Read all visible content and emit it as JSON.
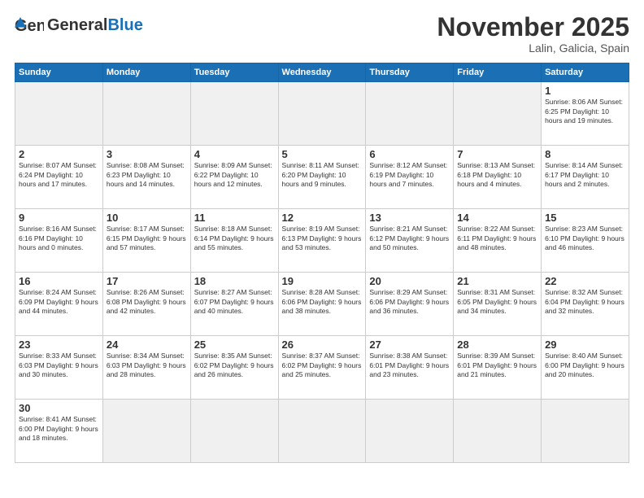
{
  "header": {
    "logo_general": "General",
    "logo_blue": "Blue",
    "month": "November 2025",
    "location": "Lalin, Galicia, Spain"
  },
  "weekdays": [
    "Sunday",
    "Monday",
    "Tuesday",
    "Wednesday",
    "Thursday",
    "Friday",
    "Saturday"
  ],
  "weeks": [
    [
      {
        "day": "",
        "info": ""
      },
      {
        "day": "",
        "info": ""
      },
      {
        "day": "",
        "info": ""
      },
      {
        "day": "",
        "info": ""
      },
      {
        "day": "",
        "info": ""
      },
      {
        "day": "",
        "info": ""
      },
      {
        "day": "1",
        "info": "Sunrise: 8:06 AM\nSunset: 6:25 PM\nDaylight: 10 hours\nand 19 minutes."
      }
    ],
    [
      {
        "day": "2",
        "info": "Sunrise: 8:07 AM\nSunset: 6:24 PM\nDaylight: 10 hours\nand 17 minutes."
      },
      {
        "day": "3",
        "info": "Sunrise: 8:08 AM\nSunset: 6:23 PM\nDaylight: 10 hours\nand 14 minutes."
      },
      {
        "day": "4",
        "info": "Sunrise: 8:09 AM\nSunset: 6:22 PM\nDaylight: 10 hours\nand 12 minutes."
      },
      {
        "day": "5",
        "info": "Sunrise: 8:11 AM\nSunset: 6:20 PM\nDaylight: 10 hours\nand 9 minutes."
      },
      {
        "day": "6",
        "info": "Sunrise: 8:12 AM\nSunset: 6:19 PM\nDaylight: 10 hours\nand 7 minutes."
      },
      {
        "day": "7",
        "info": "Sunrise: 8:13 AM\nSunset: 6:18 PM\nDaylight: 10 hours\nand 4 minutes."
      },
      {
        "day": "8",
        "info": "Sunrise: 8:14 AM\nSunset: 6:17 PM\nDaylight: 10 hours\nand 2 minutes."
      }
    ],
    [
      {
        "day": "9",
        "info": "Sunrise: 8:16 AM\nSunset: 6:16 PM\nDaylight: 10 hours\nand 0 minutes."
      },
      {
        "day": "10",
        "info": "Sunrise: 8:17 AM\nSunset: 6:15 PM\nDaylight: 9 hours\nand 57 minutes."
      },
      {
        "day": "11",
        "info": "Sunrise: 8:18 AM\nSunset: 6:14 PM\nDaylight: 9 hours\nand 55 minutes."
      },
      {
        "day": "12",
        "info": "Sunrise: 8:19 AM\nSunset: 6:13 PM\nDaylight: 9 hours\nand 53 minutes."
      },
      {
        "day": "13",
        "info": "Sunrise: 8:21 AM\nSunset: 6:12 PM\nDaylight: 9 hours\nand 50 minutes."
      },
      {
        "day": "14",
        "info": "Sunrise: 8:22 AM\nSunset: 6:11 PM\nDaylight: 9 hours\nand 48 minutes."
      },
      {
        "day": "15",
        "info": "Sunrise: 8:23 AM\nSunset: 6:10 PM\nDaylight: 9 hours\nand 46 minutes."
      }
    ],
    [
      {
        "day": "16",
        "info": "Sunrise: 8:24 AM\nSunset: 6:09 PM\nDaylight: 9 hours\nand 44 minutes."
      },
      {
        "day": "17",
        "info": "Sunrise: 8:26 AM\nSunset: 6:08 PM\nDaylight: 9 hours\nand 42 minutes."
      },
      {
        "day": "18",
        "info": "Sunrise: 8:27 AM\nSunset: 6:07 PM\nDaylight: 9 hours\nand 40 minutes."
      },
      {
        "day": "19",
        "info": "Sunrise: 8:28 AM\nSunset: 6:06 PM\nDaylight: 9 hours\nand 38 minutes."
      },
      {
        "day": "20",
        "info": "Sunrise: 8:29 AM\nSunset: 6:06 PM\nDaylight: 9 hours\nand 36 minutes."
      },
      {
        "day": "21",
        "info": "Sunrise: 8:31 AM\nSunset: 6:05 PM\nDaylight: 9 hours\nand 34 minutes."
      },
      {
        "day": "22",
        "info": "Sunrise: 8:32 AM\nSunset: 6:04 PM\nDaylight: 9 hours\nand 32 minutes."
      }
    ],
    [
      {
        "day": "23",
        "info": "Sunrise: 8:33 AM\nSunset: 6:03 PM\nDaylight: 9 hours\nand 30 minutes."
      },
      {
        "day": "24",
        "info": "Sunrise: 8:34 AM\nSunset: 6:03 PM\nDaylight: 9 hours\nand 28 minutes."
      },
      {
        "day": "25",
        "info": "Sunrise: 8:35 AM\nSunset: 6:02 PM\nDaylight: 9 hours\nand 26 minutes."
      },
      {
        "day": "26",
        "info": "Sunrise: 8:37 AM\nSunset: 6:02 PM\nDaylight: 9 hours\nand 25 minutes."
      },
      {
        "day": "27",
        "info": "Sunrise: 8:38 AM\nSunset: 6:01 PM\nDaylight: 9 hours\nand 23 minutes."
      },
      {
        "day": "28",
        "info": "Sunrise: 8:39 AM\nSunset: 6:01 PM\nDaylight: 9 hours\nand 21 minutes."
      },
      {
        "day": "29",
        "info": "Sunrise: 8:40 AM\nSunset: 6:00 PM\nDaylight: 9 hours\nand 20 minutes."
      }
    ],
    [
      {
        "day": "30",
        "info": "Sunrise: 8:41 AM\nSunset: 6:00 PM\nDaylight: 9 hours\nand 18 minutes."
      },
      {
        "day": "",
        "info": ""
      },
      {
        "day": "",
        "info": ""
      },
      {
        "day": "",
        "info": ""
      },
      {
        "day": "",
        "info": ""
      },
      {
        "day": "",
        "info": ""
      },
      {
        "day": "",
        "info": ""
      }
    ]
  ]
}
